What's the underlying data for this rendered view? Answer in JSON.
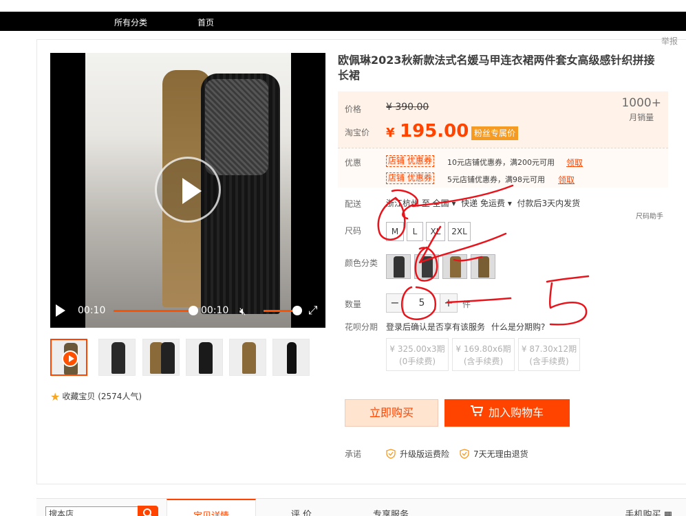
{
  "nav": {
    "all_categories": "所有分类",
    "home": "首页"
  },
  "report": "举报",
  "product": {
    "title": "欧佩琳2023秋新款法式名媛马甲连衣裙两件套女高级感针织拼接长裙"
  },
  "media": {
    "time_current": "00:10",
    "time_total": "00:10",
    "progress": 1.0,
    "volume": 0.8,
    "thumbnails": [
      "video",
      "image",
      "image",
      "image",
      "image",
      "image"
    ]
  },
  "favorite": {
    "label": "收藏宝贝",
    "count": "(2574人气)"
  },
  "price": {
    "label": "价格",
    "original": "¥ 390.00",
    "taobao_label": "淘宝价",
    "currency": "¥",
    "current": "195.00",
    "fan_badge": "粉丝专属价",
    "monthly_sales": "1000+",
    "monthly_sales_label": "月销量"
  },
  "promo": {
    "label": "优惠",
    "coupons": [
      {
        "tag": "店铺 优惠券",
        "desc": "10元店铺优惠券，满200元可用",
        "action": "领取"
      },
      {
        "tag": "店铺 优惠券",
        "desc": "5元店铺优惠券，满98元可用",
        "action": "领取"
      }
    ]
  },
  "shipping": {
    "label": "配送",
    "from": "浙江杭州 至",
    "to": "全国",
    "method": "快递 免运费",
    "dispatch": "付款后3天内发货"
  },
  "size": {
    "label": "尺码",
    "helper": "尺码助手",
    "options": [
      "M",
      "L",
      "XL",
      "2XL"
    ]
  },
  "color": {
    "label": "颜色分类",
    "swatch_count": 4
  },
  "quantity": {
    "label": "数量",
    "value": "5",
    "unit": "件",
    "minus": "−",
    "plus": "+"
  },
  "huabei": {
    "label": "花呗分期",
    "notice": "登录后确认是否享有该服务",
    "link": "什么是分期购?",
    "plans": [
      {
        "amount": "¥ 325.00x3期",
        "fee": "(0手续费)"
      },
      {
        "amount": "¥ 169.80x6期",
        "fee": "(含手续费)"
      },
      {
        "amount": "¥ 87.30x12期",
        "fee": "(含手续费)"
      }
    ]
  },
  "actions": {
    "buy_now": "立即购买",
    "add_to_cart": "加入购物车"
  },
  "promise": {
    "label": "承诺",
    "items": [
      "升级版运费险",
      "7天无理由退货"
    ]
  },
  "bottom": {
    "search_placeholder": "搜本店",
    "tabs": [
      "宝贝详情",
      "评 价",
      "专享服务"
    ],
    "mobile": "手机购买"
  },
  "annotation": {
    "handwritten": "5",
    "color": "#e8141c"
  },
  "colors": {
    "accent": "#ff4400",
    "price_bg": "#fff2e8"
  }
}
